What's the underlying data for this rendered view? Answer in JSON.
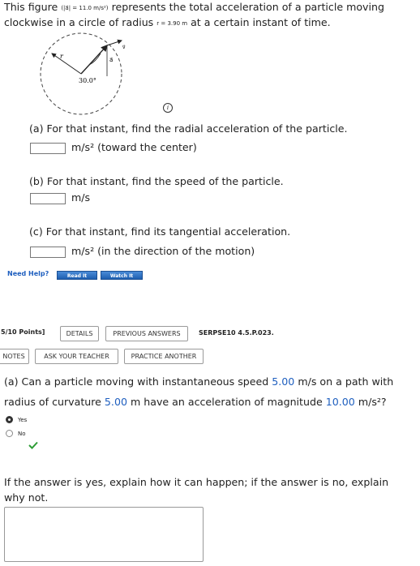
{
  "problem1": {
    "intro_pre": "This figure",
    "accel_small": "(|a⃗| = 11.0 m/s²)",
    "intro_post": "represents the total acceleration of a particle moving",
    "line2_pre": "clockwise in a circle of radius",
    "radius_small": "r = 3.90 m",
    "line2_post": "at a certain instant of time.",
    "figure": {
      "r_label": "r",
      "a_label": "a⃗",
      "v_label": "v⃗",
      "angle_label": "30.0°"
    },
    "info_icon": "i",
    "part_a": {
      "question": "(a) For that instant, find the radial acceleration of the particle.",
      "unit": "m/s² (toward the center)",
      "value": ""
    },
    "part_b": {
      "question": "(b) For that instant, find the speed of the particle.",
      "unit": "m/s",
      "value": ""
    },
    "part_c": {
      "question": "(c) For that instant, find its tangential acceleration.",
      "unit": "m/s² (in the direction of the motion)",
      "value": ""
    },
    "need_help": "Need Help?",
    "read_it": "Read It",
    "watch_it": "Watch It"
  },
  "problem2": {
    "points": "5/10 Points]",
    "details": "DETAILS",
    "previous_answers": "PREVIOUS ANSWERS",
    "code": "SERPSE10 4.5.P.023.",
    "notes": "NOTES",
    "ask_teacher": "ASK YOUR TEACHER",
    "practice_another": "PRACTICE ANOTHER",
    "q_a1": "(a) Can a particle moving with instantaneous speed",
    "speed_val": "5.00",
    "q_a2": "m/s on a path with",
    "q_b1": "radius of curvature",
    "radius_val": "5.00",
    "q_b2": "m have an acceleration of magnitude",
    "accel_val": "10.00",
    "q_b3": "m/s²?",
    "options": [
      "Yes",
      "No"
    ],
    "selected": "Yes",
    "explain1": "If the answer is yes, explain how it can happen; if the answer is no, explain",
    "explain2": "why not.",
    "explanation_text": ""
  },
  "colors": {
    "accent": "#1f5fbf",
    "correct": "#2e9d36",
    "selected_radio": "#333333"
  },
  "icons": [
    "info-icon",
    "checkmark-icon"
  ]
}
